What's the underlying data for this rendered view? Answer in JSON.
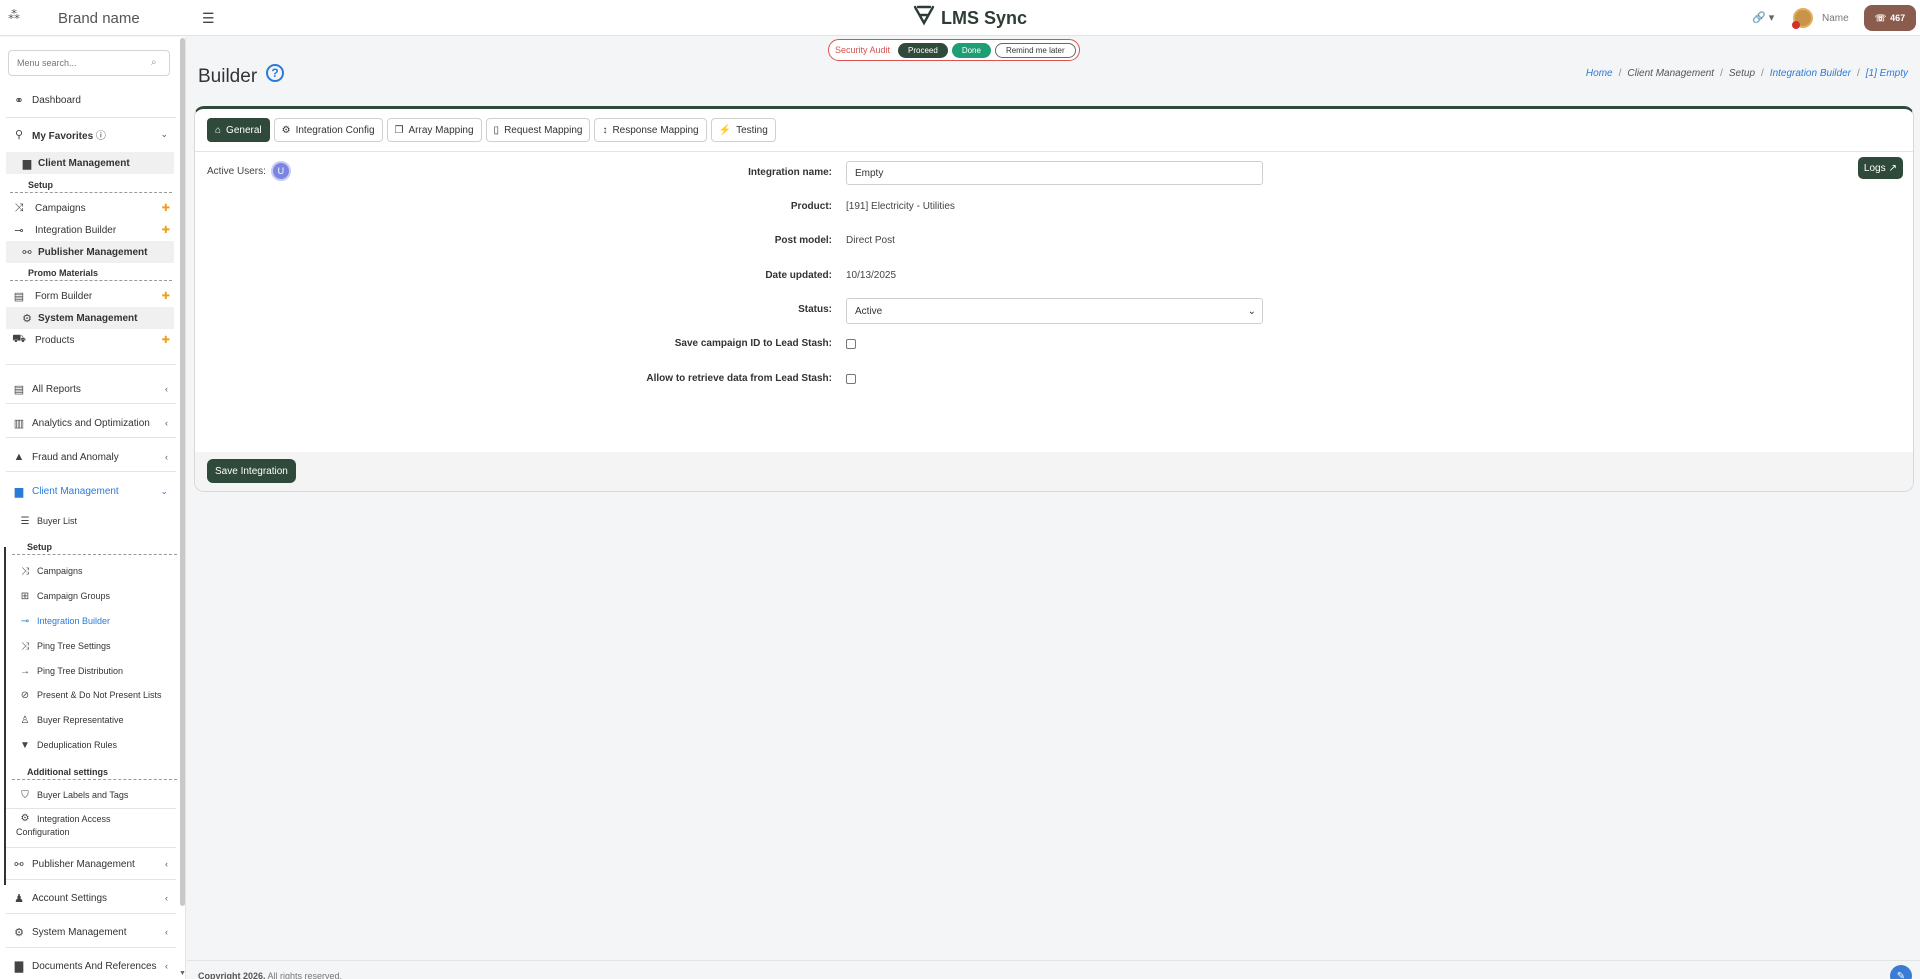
{
  "topbar": {
    "brand_icon": "sparkle-icon",
    "brand_name": "Brand name",
    "app_name": "LMS Sync",
    "link_icon": "🔗 ▾",
    "user_name": "Name",
    "support_count": "467"
  },
  "audit": {
    "label": "Security Audit",
    "proceed": "Proceed",
    "done": "Done",
    "remind": "Remind me later"
  },
  "sidebar": {
    "search_placeholder": "Menu search...",
    "dashboard": "Dashboard",
    "favorites": "My Favorites",
    "fav_client_mgmt": "Client Management",
    "fav_setup": "Setup",
    "fav_campaigns": "Campaigns",
    "fav_integration_builder": "Integration Builder",
    "fav_publisher_mgmt": "Publisher Management",
    "fav_promo": "Promo Materials",
    "fav_form_builder": "Form Builder",
    "fav_system_mgmt": "System Management",
    "fav_products": "Products",
    "all_reports": "All Reports",
    "analytics": "Analytics and Optimization",
    "fraud": "Fraud and Anomaly",
    "client_mgmt": "Client Management",
    "buyer_list": "Buyer List",
    "setup": "Setup",
    "campaigns": "Campaigns",
    "campaign_groups": "Campaign Groups",
    "integration_builder": "Integration Builder",
    "ping_tree_settings": "Ping Tree Settings",
    "ping_tree_distribution": "Ping Tree Distribution",
    "present_lists": "Present & Do Not Present Lists",
    "buyer_rep": "Buyer Representative",
    "dedup": "Deduplication Rules",
    "additional": "Additional settings",
    "labels_tags": "Buyer Labels and Tags",
    "integration_access_1": "Integration Access",
    "integration_access_2": "Configuration",
    "publisher_mgmt": "Publisher Management",
    "account_settings": "Account Settings",
    "system_mgmt": "System Management",
    "documents": "Documents And References"
  },
  "page": {
    "title": "Builder",
    "breadcrumb": {
      "home": "Home",
      "client_mgmt": "Client Management",
      "setup": "Setup",
      "integration_builder": "Integration Builder",
      "current": "[1] Empty"
    }
  },
  "tabs": {
    "general": "General",
    "integration_config": "Integration Config",
    "array_mapping": "Array Mapping",
    "request_mapping": "Request Mapping",
    "response_mapping": "Response Mapping",
    "testing": "Testing"
  },
  "form": {
    "active_users_label": "Active Users:",
    "active_user_initial": "U",
    "logs": "Logs",
    "integration_name_label": "Integration name:",
    "integration_name_value": "Empty",
    "product_label": "Product:",
    "product_value": "[191] Electricity - Utilities",
    "post_model_label": "Post model:",
    "post_model_value": "Direct Post",
    "date_updated_label": "Date updated:",
    "date_updated_value": "10/13/2025",
    "status_label": "Status:",
    "status_value": "Active",
    "save_campaign_label": "Save campaign ID to Lead Stash:",
    "save_campaign_checked": false,
    "allow_retrieve_label": "Allow to retrieve data from Lead Stash:",
    "allow_retrieve_checked": false,
    "save_button": "Save Integration"
  },
  "footer": {
    "copyright_bold": "Copyright 2026.",
    "copyright_rest": " All rights reserved."
  },
  "colors": {
    "primary_dark": "#2f4a3b",
    "link_blue": "#2a7bd8",
    "pin_orange": "#f0a020",
    "danger": "#d9534f"
  }
}
